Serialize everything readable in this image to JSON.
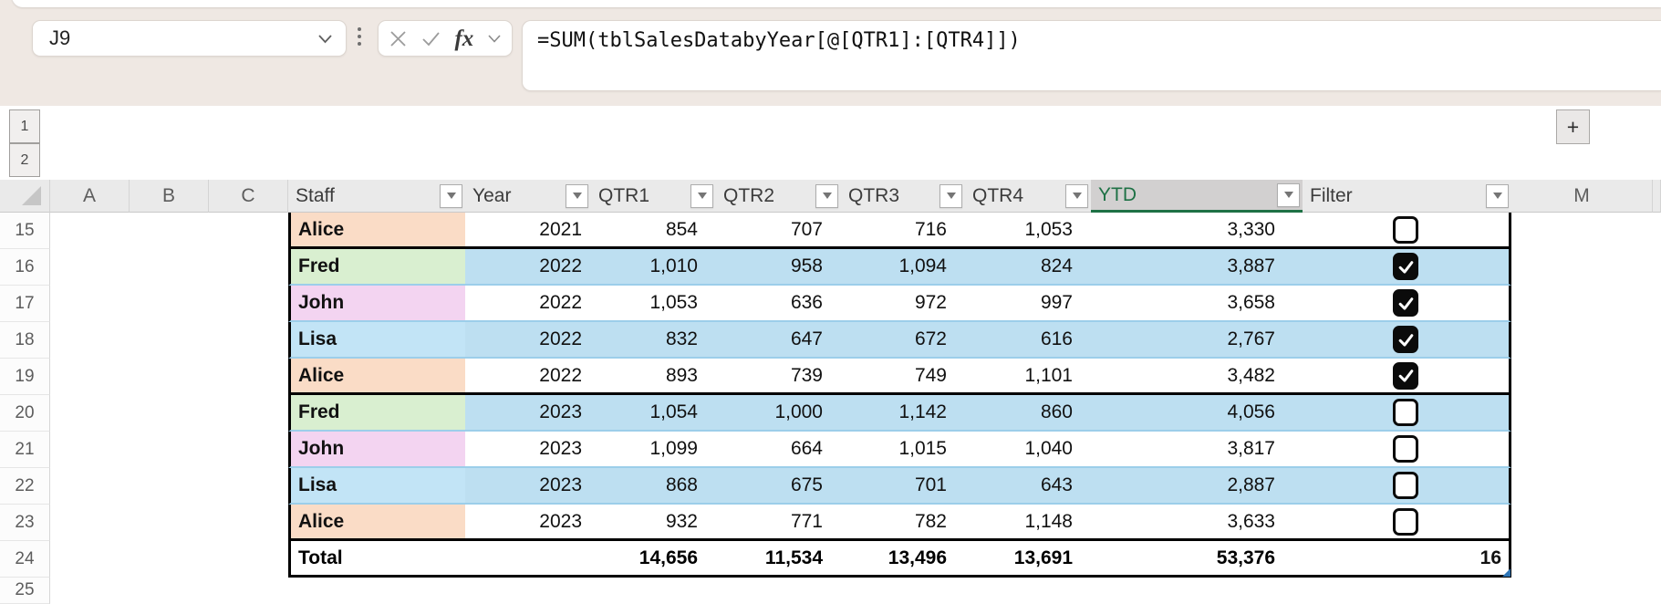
{
  "chrome": {
    "name_box": "J9",
    "formula": "=SUM(tblSalesDatabyYear[@[QTR1]:[QTR4]])",
    "fx_label": "fx"
  },
  "outline": {
    "level_1": "1",
    "level_2": "2",
    "expand": "+"
  },
  "grid": {
    "letters": [
      "A",
      "B",
      "C"
    ],
    "right_letter": "M",
    "headers": [
      {
        "label": "Staff",
        "selected": false
      },
      {
        "label": "Year",
        "selected": false
      },
      {
        "label": "QTR1",
        "selected": false
      },
      {
        "label": "QTR2",
        "selected": false
      },
      {
        "label": "QTR3",
        "selected": false
      },
      {
        "label": "QTR4",
        "selected": false
      },
      {
        "label": "YTD",
        "selected": true
      },
      {
        "label": "Filter",
        "selected": false
      }
    ],
    "rows": [
      {
        "num": "15",
        "staff": "Alice",
        "color": "alice",
        "year": "2021",
        "qtr1": "854",
        "qtr2": "707",
        "qtr3": "716",
        "qtr4": "1,053",
        "ytd": "3,330",
        "checked": false,
        "banded": false,
        "group_end": true
      },
      {
        "num": "16",
        "staff": "Fred",
        "color": "fred",
        "year": "2022",
        "qtr1": "1,010",
        "qtr2": "958",
        "qtr3": "1,094",
        "qtr4": "824",
        "ytd": "3,887",
        "checked": true,
        "banded": true,
        "group_end": false
      },
      {
        "num": "17",
        "staff": "John",
        "color": "john",
        "year": "2022",
        "qtr1": "1,053",
        "qtr2": "636",
        "qtr3": "972",
        "qtr4": "997",
        "ytd": "3,658",
        "checked": true,
        "banded": false,
        "group_end": false
      },
      {
        "num": "18",
        "staff": "Lisa",
        "color": "lisa",
        "year": "2022",
        "qtr1": "832",
        "qtr2": "647",
        "qtr3": "672",
        "qtr4": "616",
        "ytd": "2,767",
        "checked": true,
        "banded": true,
        "group_end": false
      },
      {
        "num": "19",
        "staff": "Alice",
        "color": "alice",
        "year": "2022",
        "qtr1": "893",
        "qtr2": "739",
        "qtr3": "749",
        "qtr4": "1,101",
        "ytd": "3,482",
        "checked": true,
        "banded": false,
        "group_end": true
      },
      {
        "num": "20",
        "staff": "Fred",
        "color": "fred",
        "year": "2023",
        "qtr1": "1,054",
        "qtr2": "1,000",
        "qtr3": "1,142",
        "qtr4": "860",
        "ytd": "4,056",
        "checked": false,
        "banded": true,
        "group_end": false
      },
      {
        "num": "21",
        "staff": "John",
        "color": "john",
        "year": "2023",
        "qtr1": "1,099",
        "qtr2": "664",
        "qtr3": "1,015",
        "qtr4": "1,040",
        "ytd": "3,817",
        "checked": false,
        "banded": false,
        "group_end": false
      },
      {
        "num": "22",
        "staff": "Lisa",
        "color": "lisa",
        "year": "2023",
        "qtr1": "868",
        "qtr2": "675",
        "qtr3": "701",
        "qtr4": "643",
        "ytd": "2,887",
        "checked": false,
        "banded": true,
        "group_end": false
      },
      {
        "num": "23",
        "staff": "Alice",
        "color": "alice",
        "year": "2023",
        "qtr1": "932",
        "qtr2": "771",
        "qtr3": "782",
        "qtr4": "1,148",
        "ytd": "3,633",
        "checked": false,
        "banded": false,
        "group_end": true
      }
    ],
    "total": {
      "num": "24",
      "label": "Total",
      "qtr1": "14,656",
      "qtr2": "11,534",
      "qtr3": "13,496",
      "qtr4": "13,691",
      "ytd": "53,376",
      "count": "16"
    },
    "next_row_num": "25"
  },
  "colors": {
    "chrome_bg": "#EFE8E3",
    "header_bg": "#EAEAEA",
    "selected_header_bg": "#D2D0D0",
    "accent_green": "#1E7145",
    "band": "#BDDFF1",
    "band_line": "#9CCEEA",
    "alice": "#FADCC6",
    "fred": "#D9EFD0",
    "john": "#F3D4F1",
    "lisa": "#C2E4F6",
    "handle": "#2E75B6"
  }
}
